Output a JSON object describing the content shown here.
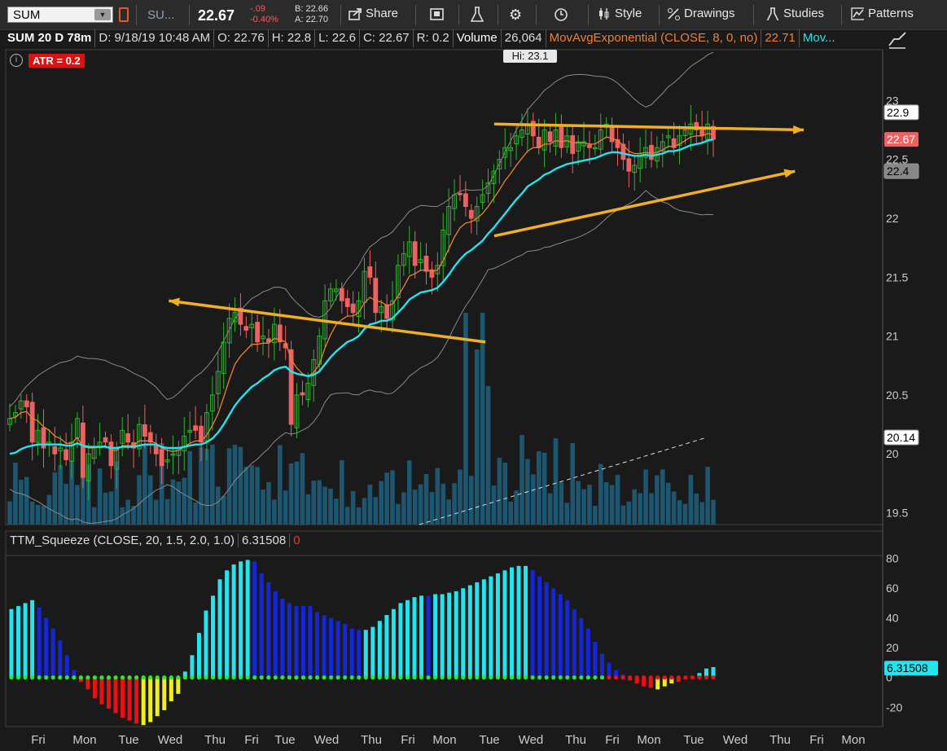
{
  "toolbar": {
    "symbol": "SUM",
    "symbol2": "SU...",
    "last": "22.67",
    "change": "-.09",
    "change_pct": "-0.40%",
    "bid": "B: 22.66",
    "ask": "A: 22.70",
    "share_label": "Share",
    "style_label": "Style",
    "drawings_label": "Drawings",
    "studies_label": "Studies",
    "patterns_label": "Patterns"
  },
  "infobar": {
    "title": "SUM 20 D 78m",
    "date": "D: 9/18/19 10:48 AM",
    "open": "O: 22.76",
    "high": "H: 22.8",
    "low": "L: 22.6",
    "close": "C: 22.67",
    "range": "R: 0.2",
    "volume_label": "Volume",
    "volume_value": "26,064",
    "ma_label": "MovAvgExponential (CLOSE, 8, 0, no)",
    "ma_value": "22.71",
    "more": "Mov..."
  },
  "atr_label": "ATR = 0.2",
  "hi_label": "Hi: 23.1",
  "squeeze": {
    "label": "TTM_Squeeze (CLOSE, 20, 1.5, 2.0, 1.0)",
    "value": "6.31508",
    "alert": "0"
  },
  "colors": {
    "up": "#2fb52f",
    "down": "#f06060",
    "ema8": "#f08030",
    "ema_slow": "#22e5f0",
    "bands": "#8a8a8a",
    "volume": "#1c5670",
    "trend_arrow": "#f0b020",
    "sq_cyan": "#22e5f0",
    "sq_blue": "#1525d8",
    "sq_red": "#ee1010",
    "sq_yellow": "#f0f020",
    "dot_green": "#22ee22",
    "dot_red": "#ee1010"
  },
  "chart_data": [
    {
      "type": "candlestick",
      "title": "SUM 20 D 78m",
      "ylim": [
        19.4,
        23.3
      ],
      "y_ticks": [
        "19.5",
        "20",
        "20.5",
        "21",
        "21.5",
        "22",
        "22.5",
        "23"
      ],
      "x_ticks": [
        "Fri",
        "Mon",
        "Tue",
        "Wed",
        "Thu",
        "Fri",
        "Tue",
        "Wed",
        "Thu",
        "Fri",
        "Mon",
        "Tue",
        "Wed",
        "Thu",
        "Fri",
        "Mon",
        "Tue",
        "Wed",
        "Thu",
        "Fri",
        "Mon"
      ],
      "price_labels": [
        {
          "value": 22.9,
          "text": "22.9"
        },
        {
          "value": 22.67,
          "text": "22.67"
        },
        {
          "value": 22.4,
          "text": "22.4"
        },
        {
          "value": 20.14,
          "text": "20.14"
        }
      ],
      "close": [
        20.3,
        20.35,
        20.45,
        20.4,
        20.1,
        20.2,
        20.05,
        20.1,
        20.0,
        20.05,
        19.95,
        20.1,
        20.3,
        19.8,
        20.0,
        20.05,
        20.1,
        20.1,
        19.9,
        20.05,
        20.2,
        20.1,
        20.05,
        20.25,
        20.15,
        20.1,
        20.0,
        19.9,
        19.95,
        20.0,
        20.05,
        20.15,
        20.2,
        20.2,
        20.1,
        20.35,
        20.5,
        20.7,
        20.95,
        21.15,
        21.2,
        21.1,
        21.05,
        21.1,
        20.95,
        21.0,
        20.95,
        21.1,
        20.95,
        20.9,
        20.25,
        20.5,
        20.5,
        20.6,
        20.8,
        21.0,
        21.3,
        21.4,
        21.4,
        21.3,
        21.25,
        21.2,
        21.3,
        21.55,
        21.5,
        21.2,
        21.25,
        21.15,
        21.3,
        21.6,
        21.7,
        21.8,
        21.6,
        21.65,
        21.55,
        21.5,
        21.6,
        21.9,
        22.1,
        22.2,
        22.2,
        22.1,
        22.0,
        22.1,
        22.2,
        22.3,
        22.4,
        22.5,
        22.6,
        22.6,
        22.7,
        22.75,
        22.8,
        22.7,
        22.6,
        22.75,
        22.65,
        22.75,
        22.6,
        22.7,
        22.55,
        22.65,
        22.65,
        22.6,
        22.6,
        22.75,
        22.8,
        22.65,
        22.6,
        22.5,
        22.4,
        22.45,
        22.55,
        22.6,
        22.5,
        22.6,
        22.65,
        22.7,
        22.6,
        22.7,
        22.75,
        22.8,
        22.75,
        22.7,
        22.8,
        22.67
      ],
      "volume_scale": [
        60,
        80,
        80,
        60,
        95,
        55
      ],
      "ema8": [
        20.3,
        20.31,
        20.35,
        20.36,
        20.3,
        20.28,
        20.23,
        20.2,
        20.15,
        20.13,
        20.09,
        20.09,
        20.14,
        20.06,
        20.05,
        20.05,
        20.06,
        20.07,
        20.03,
        20.03,
        20.07,
        20.07,
        20.07,
        20.11,
        20.11,
        20.11,
        20.09,
        20.05,
        20.03,
        20.02,
        20.03,
        20.06,
        20.09,
        20.11,
        20.11,
        20.16,
        20.24,
        20.34,
        20.48,
        20.63,
        20.76,
        20.83,
        20.88,
        20.93,
        20.93,
        20.94,
        20.94,
        20.98,
        20.97,
        20.95,
        20.8,
        20.73,
        20.68,
        20.66,
        20.69,
        20.76,
        20.9,
        21.01,
        21.1,
        21.14,
        21.17,
        21.17,
        21.2,
        21.28,
        21.33,
        21.3,
        21.29,
        21.26,
        21.27,
        21.34,
        21.42,
        21.51,
        21.53,
        21.56,
        21.56,
        21.55,
        21.56,
        21.64,
        21.74,
        21.84,
        21.92,
        21.96,
        21.97,
        22.0,
        22.04,
        22.1,
        22.17,
        22.24,
        22.32,
        22.38,
        22.45,
        22.51,
        22.57,
        22.6,
        22.6,
        22.63,
        22.63,
        22.66,
        22.65,
        22.66,
        22.64,
        22.64,
        22.64,
        22.63,
        22.63,
        22.66,
        22.69,
        22.68,
        22.66,
        22.62,
        22.57,
        22.55,
        22.55,
        22.56,
        22.55,
        22.56,
        22.58,
        22.61,
        22.61,
        22.63,
        22.66,
        22.69,
        22.7,
        22.7,
        22.72,
        22.71
      ],
      "ema_slow": [
        20.0,
        20.01,
        20.04,
        20.06,
        20.07,
        20.08,
        20.08,
        20.08,
        20.08,
        20.08,
        20.07,
        20.07,
        20.09,
        20.07,
        20.06,
        20.06,
        20.06,
        20.06,
        20.05,
        20.05,
        20.06,
        20.06,
        20.06,
        20.07,
        20.08,
        20.08,
        20.08,
        20.06,
        20.05,
        20.05,
        20.05,
        20.06,
        20.07,
        20.08,
        20.08,
        20.1,
        20.13,
        20.18,
        20.25,
        20.33,
        20.41,
        20.47,
        20.52,
        20.57,
        20.6,
        20.64,
        20.67,
        20.71,
        20.73,
        20.74,
        20.7,
        20.68,
        20.67,
        20.66,
        20.67,
        20.7,
        20.76,
        20.82,
        20.87,
        20.91,
        20.95,
        20.97,
        21.0,
        21.06,
        21.1,
        21.11,
        21.13,
        21.13,
        21.15,
        21.2,
        21.25,
        21.31,
        21.34,
        21.37,
        21.38,
        21.39,
        21.41,
        21.46,
        21.52,
        21.59,
        21.65,
        21.7,
        21.73,
        21.77,
        21.81,
        21.87,
        21.92,
        21.98,
        22.04,
        22.1,
        22.16,
        22.21,
        22.27,
        22.3,
        22.33,
        22.37,
        22.39,
        22.42,
        22.44,
        22.46,
        22.47,
        22.48,
        22.49,
        22.5,
        22.51,
        22.53,
        22.55,
        22.56,
        22.56,
        22.55,
        22.54,
        22.53,
        22.53,
        22.54,
        22.53,
        22.54,
        22.55,
        22.57,
        22.57,
        22.58,
        22.6,
        22.62,
        22.63,
        22.64,
        22.66,
        22.67
      ],
      "trend_lines": [
        {
          "from": [
            0.547,
            20.95
          ],
          "to": [
            0.186,
            21.3
          ]
        },
        {
          "from": [
            0.557,
            22.8
          ],
          "to": [
            0.91,
            22.75
          ]
        },
        {
          "from": [
            0.557,
            21.85
          ],
          "to": [
            0.9,
            22.4
          ]
        }
      ]
    },
    {
      "type": "bar",
      "title": "TTM_Squeeze (CLOSE, 20, 1.5, 2.0, 1.0)",
      "ylim": [
        -33,
        82
      ],
      "y_ticks": [
        "-20",
        "0",
        "20",
        "40",
        "60",
        "80"
      ],
      "current_value_label": "6.31508",
      "values": [
        46,
        48,
        50,
        52,
        47,
        40,
        33,
        25,
        15,
        5,
        -3,
        -8,
        -14,
        -18,
        -21,
        -24,
        -27,
        -29,
        -31,
        -32,
        -30,
        -26,
        -22,
        -16,
        -11,
        4,
        15,
        30,
        45,
        55,
        66,
        72,
        76,
        78,
        79,
        78,
        70,
        64,
        58,
        53,
        50,
        48,
        48,
        48,
        44,
        42,
        40,
        38,
        36,
        33,
        32,
        32,
        34,
        38,
        42,
        46,
        50,
        52,
        54,
        55,
        55,
        56,
        56,
        57,
        58,
        60,
        62,
        64,
        66,
        68,
        70,
        72,
        74,
        75,
        75,
        72,
        68,
        64,
        60,
        56,
        52,
        46,
        40,
        33,
        24,
        16,
        10,
        5,
        2,
        -2,
        -4,
        -6,
        -7,
        -8,
        -6,
        -4,
        -3,
        -1,
        1,
        3,
        6,
        7
      ],
      "colors": [
        "cyan",
        "cyan",
        "cyan",
        "cyan",
        "blue",
        "blue",
        "blue",
        "blue",
        "blue",
        "blue",
        "red",
        "red",
        "red",
        "red",
        "red",
        "red",
        "red",
        "red",
        "red",
        "yellow",
        "yellow",
        "yellow",
        "yellow",
        "yellow",
        "yellow",
        "cyan",
        "cyan",
        "cyan",
        "cyan",
        "cyan",
        "cyan",
        "cyan",
        "cyan",
        "cyan",
        "cyan",
        "blue",
        "blue",
        "blue",
        "blue",
        "blue",
        "blue",
        "blue",
        "blue",
        "blue",
        "blue",
        "blue",
        "blue",
        "blue",
        "blue",
        "blue",
        "blue",
        "cyan",
        "cyan",
        "cyan",
        "cyan",
        "cyan",
        "cyan",
        "cyan",
        "cyan",
        "cyan",
        "blue",
        "cyan",
        "cyan",
        "cyan",
        "cyan",
        "cyan",
        "cyan",
        "cyan",
        "cyan",
        "cyan",
        "cyan",
        "cyan",
        "cyan",
        "cyan",
        "cyan",
        "blue",
        "blue",
        "blue",
        "blue",
        "blue",
        "blue",
        "blue",
        "blue",
        "blue",
        "blue",
        "blue",
        "blue",
        "blue",
        "blue",
        "red",
        "red",
        "red",
        "red",
        "yellow",
        "yellow",
        "yellow",
        "red",
        "red",
        "red",
        "cyan",
        "cyan",
        "cyan"
      ]
    }
  ]
}
